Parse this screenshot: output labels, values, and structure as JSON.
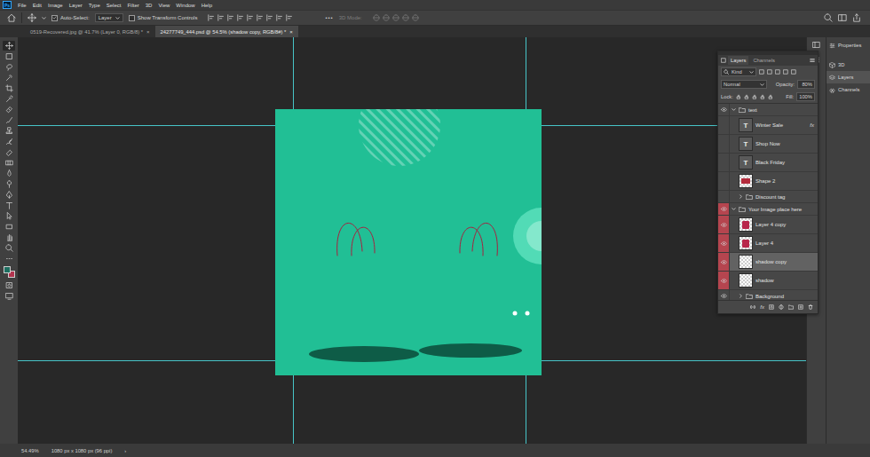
{
  "app": {
    "logo": "Ps"
  },
  "menu": [
    "File",
    "Edit",
    "Image",
    "Layer",
    "Type",
    "Select",
    "Filter",
    "3D",
    "View",
    "Window",
    "Help"
  ],
  "options": {
    "auto_select": {
      "label": "Auto-Select:",
      "checked": true
    },
    "target": "Layer",
    "transform": {
      "label": "Show Transform Controls",
      "checked": false
    },
    "more": "•••",
    "mode_3d": {
      "label": "3D Mode:",
      "disabled": true
    }
  },
  "doc_tabs": [
    {
      "label": "0519-Recovered.jpg @ 41.7% (Layer 0, RGB/8) *",
      "close": "×",
      "selected": false
    },
    {
      "label": "24277749_444.psd @ 54.5% (shadow copy, RGB/8#) *",
      "close": "×",
      "selected": true
    }
  ],
  "tools": [
    {
      "kind": "move",
      "selected": true
    },
    {
      "kind": "marquee",
      "selected": false
    },
    {
      "kind": "lasso",
      "selected": false
    },
    {
      "kind": "quickselect",
      "selected": false
    },
    {
      "kind": "crop",
      "selected": false
    },
    {
      "kind": "eyedropper",
      "selected": false
    },
    {
      "kind": "heal",
      "selected": false
    },
    {
      "kind": "brush",
      "selected": false
    },
    {
      "kind": "stamp",
      "selected": false
    },
    {
      "kind": "history",
      "selected": false
    },
    {
      "kind": "eraser",
      "selected": false
    },
    {
      "kind": "gradient",
      "selected": false
    },
    {
      "kind": "blur",
      "selected": false
    },
    {
      "kind": "dodge",
      "selected": false
    },
    {
      "kind": "pen",
      "selected": false
    },
    {
      "kind": "type",
      "selected": false
    },
    {
      "kind": "path",
      "selected": false
    },
    {
      "kind": "rect",
      "selected": false
    },
    {
      "kind": "hand",
      "selected": false
    },
    {
      "kind": "zoom",
      "selected": false
    },
    {
      "kind": "more",
      "selected": false
    }
  ],
  "swatches": {
    "foreground": "#1d6e60",
    "background": "#b3344f"
  },
  "tools_bottom": [
    {
      "kind": "quickmask",
      "selected": false
    },
    {
      "kind": "screen",
      "selected": false
    }
  ],
  "layers_panel": {
    "tabs": [
      {
        "label": "Layers",
        "selected": true
      },
      {
        "label": "Channels",
        "selected": false
      }
    ],
    "filter": "Kind",
    "blend_mode": "Normal",
    "opacity": {
      "label": "Opacity:",
      "value": "80%"
    },
    "lock": "Lock:",
    "fill": {
      "label": "Fill:",
      "value": "100%"
    },
    "footer_fx": "fx",
    "layers": [
      {
        "kind": "group",
        "name": "text",
        "visible": true,
        "expanded": true,
        "selected": false,
        "layers": [
          {
            "kind": "text",
            "name": "Winter Sale",
            "icon": "T",
            "fx": "fx",
            "visible": false,
            "selected": false
          },
          {
            "kind": "text",
            "name": "Shop Now",
            "icon": "T",
            "visible": false,
            "selected": false
          },
          {
            "kind": "text",
            "name": "Black Friday",
            "icon": "T",
            "visible": false,
            "selected": false
          },
          {
            "kind": "shape",
            "name": "Shape 2",
            "visible": false,
            "selected": false
          },
          {
            "kind": "group",
            "name": "Discount tag",
            "visible": false,
            "expanded": false,
            "selected": false,
            "layers": []
          }
        ]
      },
      {
        "kind": "group",
        "name": "Your Image place here",
        "visible": true,
        "expanded": true,
        "selected": false,
        "color": "#b5454f",
        "layers": [
          {
            "kind": "image",
            "name": "Layer 4 copy",
            "visible": true,
            "selected": false,
            "color": "#b5454f"
          },
          {
            "kind": "image",
            "name": "Layer 4",
            "visible": true,
            "selected": false,
            "color": "#b5454f"
          },
          {
            "kind": "pixel",
            "name": "shadow copy",
            "visible": true,
            "selected": true,
            "color": "#b5454f"
          },
          {
            "kind": "pixel",
            "name": "shadow",
            "visible": true,
            "selected": false,
            "color": "#b5454f"
          },
          {
            "kind": "group",
            "name": "Background",
            "visible": true,
            "expanded": false,
            "selected": false,
            "layers": []
          }
        ]
      }
    ]
  },
  "dock": [
    {
      "label": "Properties",
      "selected": false
    },
    {
      "label": "3D",
      "selected": false
    },
    {
      "label": "Layers",
      "selected": true
    },
    {
      "label": "Channels",
      "selected": false
    }
  ],
  "status": {
    "zoom": "54.49%",
    "doc_size": "1080 px x 1080 px (96 ppi)",
    "arrow": "›"
  }
}
